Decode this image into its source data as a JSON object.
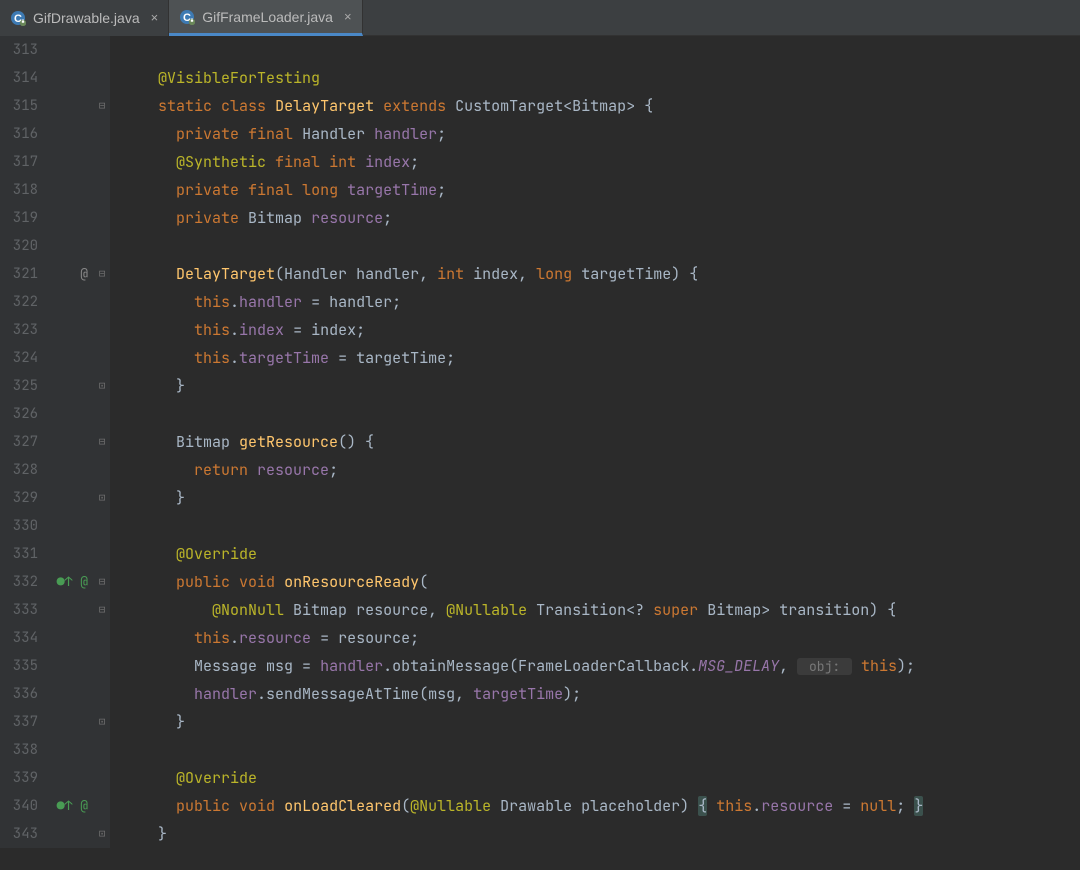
{
  "tabs": [
    {
      "name": "GifDrawable.java",
      "active": false
    },
    {
      "name": "GifFrameLoader.java",
      "active": true
    }
  ],
  "lines": [
    {
      "num": "313",
      "mk": "",
      "fd": "",
      "tokens": []
    },
    {
      "num": "314",
      "mk": "",
      "fd": "",
      "tokens": [
        {
          "t": "    ",
          "c": ""
        },
        {
          "t": "@VisibleForTesting",
          "c": "ann"
        }
      ]
    },
    {
      "num": "315",
      "mk": "",
      "fd": "⊟",
      "tokens": [
        {
          "t": "    ",
          "c": ""
        },
        {
          "t": "static",
          "c": "kw"
        },
        {
          "t": " ",
          "c": ""
        },
        {
          "t": "class",
          "c": "kw"
        },
        {
          "t": " ",
          "c": ""
        },
        {
          "t": "DelayTarget",
          "c": "name"
        },
        {
          "t": " ",
          "c": ""
        },
        {
          "t": "extends",
          "c": "kw"
        },
        {
          "t": " ",
          "c": ""
        },
        {
          "t": "CustomTarget",
          "c": "cls"
        },
        {
          "t": "<",
          "c": "punc"
        },
        {
          "t": "Bitmap",
          "c": "cls"
        },
        {
          "t": "> {",
          "c": "punc"
        }
      ]
    },
    {
      "num": "316",
      "mk": "",
      "fd": "",
      "tokens": [
        {
          "t": "      ",
          "c": ""
        },
        {
          "t": "private",
          "c": "kw"
        },
        {
          "t": " ",
          "c": ""
        },
        {
          "t": "final",
          "c": "kw"
        },
        {
          "t": " ",
          "c": ""
        },
        {
          "t": "Handler ",
          "c": "cls"
        },
        {
          "t": "handler",
          "c": "fld"
        },
        {
          "t": ";",
          "c": "punc"
        }
      ]
    },
    {
      "num": "317",
      "mk": "",
      "fd": "",
      "tokens": [
        {
          "t": "      ",
          "c": ""
        },
        {
          "t": "@Synthetic",
          "c": "ann"
        },
        {
          "t": " ",
          "c": ""
        },
        {
          "t": "final",
          "c": "kw"
        },
        {
          "t": " ",
          "c": ""
        },
        {
          "t": "int",
          "c": "kw"
        },
        {
          "t": " ",
          "c": ""
        },
        {
          "t": "index",
          "c": "fld"
        },
        {
          "t": ";",
          "c": "punc"
        }
      ]
    },
    {
      "num": "318",
      "mk": "",
      "fd": "",
      "tokens": [
        {
          "t": "      ",
          "c": ""
        },
        {
          "t": "private",
          "c": "kw"
        },
        {
          "t": " ",
          "c": ""
        },
        {
          "t": "final",
          "c": "kw"
        },
        {
          "t": " ",
          "c": ""
        },
        {
          "t": "long",
          "c": "kw"
        },
        {
          "t": " ",
          "c": ""
        },
        {
          "t": "targetTime",
          "c": "fld"
        },
        {
          "t": ";",
          "c": "punc"
        }
      ]
    },
    {
      "num": "319",
      "mk": "",
      "fd": "",
      "tokens": [
        {
          "t": "      ",
          "c": ""
        },
        {
          "t": "private",
          "c": "kw"
        },
        {
          "t": " ",
          "c": ""
        },
        {
          "t": "Bitmap ",
          "c": "cls"
        },
        {
          "t": "resource",
          "c": "fld"
        },
        {
          "t": ";",
          "c": "punc"
        }
      ]
    },
    {
      "num": "320",
      "mk": "",
      "fd": "",
      "tokens": []
    },
    {
      "num": "321",
      "mk": "@",
      "fd": "⊟",
      "tokens": [
        {
          "t": "      ",
          "c": ""
        },
        {
          "t": "DelayTarget",
          "c": "name"
        },
        {
          "t": "(",
          "c": "punc"
        },
        {
          "t": "Handler ",
          "c": "cls"
        },
        {
          "t": "handler",
          "c": "par"
        },
        {
          "t": ", ",
          "c": "punc"
        },
        {
          "t": "int",
          "c": "kw"
        },
        {
          "t": " ",
          "c": ""
        },
        {
          "t": "index",
          "c": "par"
        },
        {
          "t": ", ",
          "c": "punc"
        },
        {
          "t": "long",
          "c": "kw"
        },
        {
          "t": " ",
          "c": ""
        },
        {
          "t": "targetTime",
          "c": "par"
        },
        {
          "t": ") {",
          "c": "punc"
        }
      ]
    },
    {
      "num": "322",
      "mk": "",
      "fd": "",
      "tokens": [
        {
          "t": "        ",
          "c": ""
        },
        {
          "t": "this",
          "c": "kw"
        },
        {
          "t": ".",
          "c": "punc"
        },
        {
          "t": "handler",
          "c": "fld"
        },
        {
          "t": " = ",
          "c": "punc"
        },
        {
          "t": "handler",
          "c": "par"
        },
        {
          "t": ";",
          "c": "punc"
        }
      ]
    },
    {
      "num": "323",
      "mk": "",
      "fd": "",
      "tokens": [
        {
          "t": "        ",
          "c": ""
        },
        {
          "t": "this",
          "c": "kw"
        },
        {
          "t": ".",
          "c": "punc"
        },
        {
          "t": "index",
          "c": "fld"
        },
        {
          "t": " = ",
          "c": "punc"
        },
        {
          "t": "index",
          "c": "par"
        },
        {
          "t": ";",
          "c": "punc"
        }
      ]
    },
    {
      "num": "324",
      "mk": "",
      "fd": "",
      "tokens": [
        {
          "t": "        ",
          "c": ""
        },
        {
          "t": "this",
          "c": "kw"
        },
        {
          "t": ".",
          "c": "punc"
        },
        {
          "t": "targetTime",
          "c": "fld"
        },
        {
          "t": " = ",
          "c": "punc"
        },
        {
          "t": "targetTime",
          "c": "par"
        },
        {
          "t": ";",
          "c": "punc"
        }
      ]
    },
    {
      "num": "325",
      "mk": "",
      "fd": "⊟̂",
      "tokens": [
        {
          "t": "      ",
          "c": ""
        },
        {
          "t": "}",
          "c": "punc"
        }
      ]
    },
    {
      "num": "326",
      "mk": "",
      "fd": "",
      "tokens": []
    },
    {
      "num": "327",
      "mk": "",
      "fd": "⊟",
      "tokens": [
        {
          "t": "      ",
          "c": ""
        },
        {
          "t": "Bitmap ",
          "c": "cls"
        },
        {
          "t": "getResource",
          "c": "name"
        },
        {
          "t": "() {",
          "c": "punc"
        }
      ]
    },
    {
      "num": "328",
      "mk": "",
      "fd": "",
      "tokens": [
        {
          "t": "        ",
          "c": ""
        },
        {
          "t": "return",
          "c": "kw"
        },
        {
          "t": " ",
          "c": ""
        },
        {
          "t": "resource",
          "c": "fld"
        },
        {
          "t": ";",
          "c": "punc"
        }
      ]
    },
    {
      "num": "329",
      "mk": "",
      "fd": "⊟̂",
      "tokens": [
        {
          "t": "      ",
          "c": ""
        },
        {
          "t": "}",
          "c": "punc"
        }
      ]
    },
    {
      "num": "330",
      "mk": "",
      "fd": "",
      "tokens": []
    },
    {
      "num": "331",
      "mk": "",
      "fd": "",
      "tokens": [
        {
          "t": "      ",
          "c": ""
        },
        {
          "t": "@Override",
          "c": "ann"
        }
      ]
    },
    {
      "num": "332",
      "mk": "●↑ @",
      "fd": "⊟",
      "tokens": [
        {
          "t": "      ",
          "c": ""
        },
        {
          "t": "public",
          "c": "kw"
        },
        {
          "t": " ",
          "c": ""
        },
        {
          "t": "void",
          "c": "kw"
        },
        {
          "t": " ",
          "c": ""
        },
        {
          "t": "onResourceReady",
          "c": "name"
        },
        {
          "t": "(",
          "c": "punc"
        }
      ]
    },
    {
      "num": "333",
      "mk": "",
      "fd": "⊟",
      "tokens": [
        {
          "t": "          ",
          "c": ""
        },
        {
          "t": "@NonNull",
          "c": "ann"
        },
        {
          "t": " ",
          "c": ""
        },
        {
          "t": "Bitmap ",
          "c": "cls"
        },
        {
          "t": "resource",
          "c": "par"
        },
        {
          "t": ", ",
          "c": "punc"
        },
        {
          "t": "@Nullable",
          "c": "ann"
        },
        {
          "t": " ",
          "c": ""
        },
        {
          "t": "Transition",
          "c": "cls"
        },
        {
          "t": "<? ",
          "c": "punc"
        },
        {
          "t": "super",
          "c": "kw"
        },
        {
          "t": " ",
          "c": ""
        },
        {
          "t": "Bitmap",
          "c": "cls"
        },
        {
          "t": "> ",
          "c": "punc"
        },
        {
          "t": "transition",
          "c": "par"
        },
        {
          "t": ") {",
          "c": "punc"
        }
      ]
    },
    {
      "num": "334",
      "mk": "",
      "fd": "",
      "tokens": [
        {
          "t": "        ",
          "c": ""
        },
        {
          "t": "this",
          "c": "kw"
        },
        {
          "t": ".",
          "c": "punc"
        },
        {
          "t": "resource",
          "c": "fld"
        },
        {
          "t": " = ",
          "c": "punc"
        },
        {
          "t": "resource",
          "c": "par"
        },
        {
          "t": ";",
          "c": "punc"
        }
      ]
    },
    {
      "num": "335",
      "mk": "",
      "fd": "",
      "tokens": [
        {
          "t": "        ",
          "c": ""
        },
        {
          "t": "Message ",
          "c": "cls"
        },
        {
          "t": "msg",
          "c": "par"
        },
        {
          "t": " = ",
          "c": "punc"
        },
        {
          "t": "handler",
          "c": "fld"
        },
        {
          "t": ".",
          "c": "punc"
        },
        {
          "t": "obtainMessage",
          "c": "par"
        },
        {
          "t": "(",
          "c": "punc"
        },
        {
          "t": "FrameLoaderCallback",
          "c": "cls"
        },
        {
          "t": ".",
          "c": "punc"
        },
        {
          "t": "MSG_DELAY",
          "c": "cnst"
        },
        {
          "t": ", ",
          "c": "punc"
        },
        {
          "t": " obj: ",
          "c": "hint"
        },
        {
          "t": " ",
          "c": ""
        },
        {
          "t": "this",
          "c": "kw"
        },
        {
          "t": ");",
          "c": "punc"
        }
      ]
    },
    {
      "num": "336",
      "mk": "",
      "fd": "",
      "tokens": [
        {
          "t": "        ",
          "c": ""
        },
        {
          "t": "handler",
          "c": "fld"
        },
        {
          "t": ".",
          "c": "punc"
        },
        {
          "t": "sendMessageAtTime",
          "c": "par"
        },
        {
          "t": "(",
          "c": "punc"
        },
        {
          "t": "msg",
          "c": "par"
        },
        {
          "t": ", ",
          "c": "punc"
        },
        {
          "t": "targetTime",
          "c": "fld"
        },
        {
          "t": ");",
          "c": "punc"
        }
      ]
    },
    {
      "num": "337",
      "mk": "",
      "fd": "⊟̂",
      "tokens": [
        {
          "t": "      ",
          "c": ""
        },
        {
          "t": "}",
          "c": "punc"
        }
      ]
    },
    {
      "num": "338",
      "mk": "",
      "fd": "",
      "tokens": []
    },
    {
      "num": "339",
      "mk": "",
      "fd": "",
      "tokens": [
        {
          "t": "      ",
          "c": ""
        },
        {
          "t": "@Override",
          "c": "ann"
        }
      ]
    },
    {
      "num": "340",
      "mk": "●↑ @",
      "fd": "",
      "tokens": [
        {
          "t": "      ",
          "c": ""
        },
        {
          "t": "public",
          "c": "kw"
        },
        {
          "t": " ",
          "c": ""
        },
        {
          "t": "void",
          "c": "kw"
        },
        {
          "t": " ",
          "c": ""
        },
        {
          "t": "onLoadCleared",
          "c": "name"
        },
        {
          "t": "(",
          "c": "punc"
        },
        {
          "t": "@Nullable",
          "c": "ann"
        },
        {
          "t": " ",
          "c": ""
        },
        {
          "t": "Drawable ",
          "c": "cls"
        },
        {
          "t": "placeholder",
          "c": "par"
        },
        {
          "t": ") ",
          "c": "punc"
        },
        {
          "t": "{",
          "c": "punc brace-hl"
        },
        {
          "t": " ",
          "c": ""
        },
        {
          "t": "this",
          "c": "kw"
        },
        {
          "t": ".",
          "c": "punc"
        },
        {
          "t": "resource",
          "c": "fld"
        },
        {
          "t": " = ",
          "c": "punc"
        },
        {
          "t": "null",
          "c": "kw"
        },
        {
          "t": "; ",
          "c": "punc"
        },
        {
          "t": "}",
          "c": "punc brace-hl"
        }
      ]
    },
    {
      "num": "343",
      "mk": "",
      "fd": "⊟̂",
      "tokens": [
        {
          "t": "    ",
          "c": ""
        },
        {
          "t": "}",
          "c": "punc"
        }
      ]
    }
  ]
}
